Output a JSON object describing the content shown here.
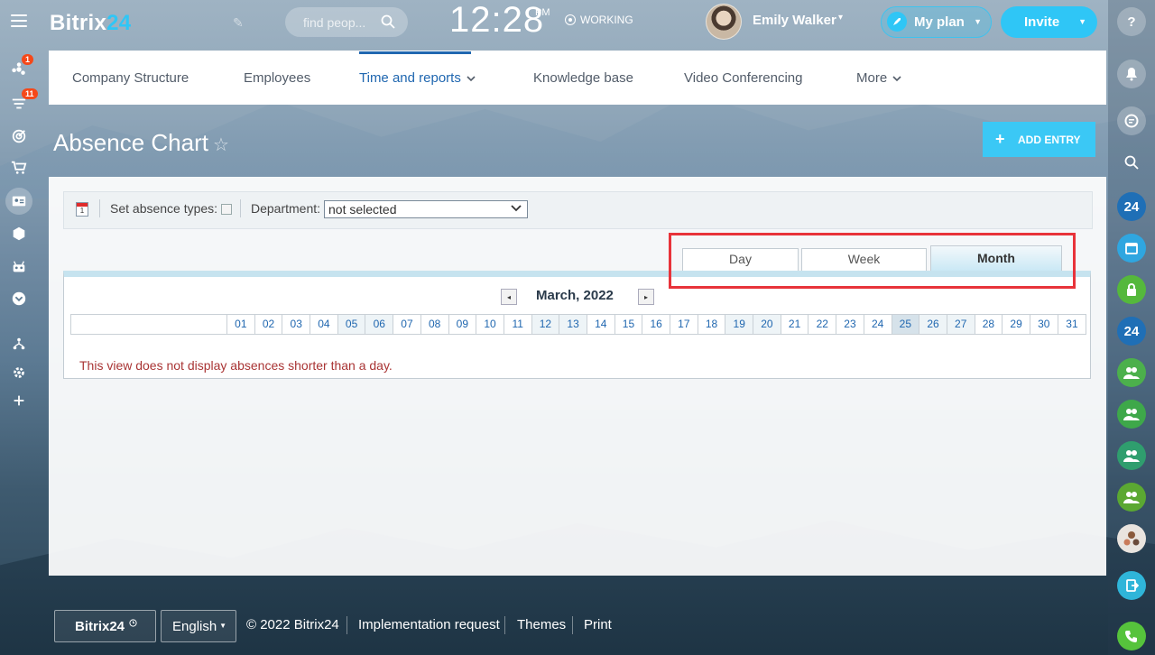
{
  "header": {
    "logo_part1": "Bitrix",
    "logo_part2": "24",
    "search_placeholder": "find peop...",
    "clock_time": "12:28",
    "clock_ampm": "PM",
    "work_status": "WORKING",
    "user_name": "Emily Walker",
    "myplan_label": "My plan",
    "invite_label": "Invite"
  },
  "left_sidebar": {
    "badges": {
      "notifications": "1",
      "feed": "11"
    }
  },
  "right_sidebar": {
    "items": [
      "help-icon",
      "bell-icon",
      "chat-icon",
      "search-icon",
      "b24-icon",
      "calendar-icon",
      "lock-icon",
      "b24-icon",
      "group-icon",
      "group-icon",
      "group-icon",
      "group-icon",
      "avatars-icon",
      "exit-icon",
      "phone-icon"
    ],
    "b24_text": "24"
  },
  "nav": {
    "items": [
      {
        "label": "Company Structure"
      },
      {
        "label": "Employees"
      },
      {
        "label": "Time and reports"
      },
      {
        "label": "Knowledge base"
      },
      {
        "label": "Video Conferencing"
      },
      {
        "label": "More"
      }
    ],
    "active": "Time and reports"
  },
  "page": {
    "title": "Absence Chart",
    "add_entry_label": "ADD ENTRY"
  },
  "toolbar": {
    "calendar_day": "1",
    "absence_types_label": "Set absence types:",
    "department_label": "Department:",
    "department_value": "not selected"
  },
  "view_tabs": [
    {
      "label": "Day"
    },
    {
      "label": "Week"
    },
    {
      "label": "Month"
    }
  ],
  "chart": {
    "month_label": "March, 2022",
    "days": [
      "01",
      "02",
      "03",
      "04",
      "05",
      "06",
      "07",
      "08",
      "09",
      "10",
      "11",
      "12",
      "13",
      "14",
      "15",
      "16",
      "17",
      "18",
      "19",
      "20",
      "21",
      "22",
      "23",
      "24",
      "25",
      "26",
      "27",
      "28",
      "29",
      "30",
      "31"
    ],
    "weekend_days": [
      "05",
      "06",
      "12",
      "13",
      "19",
      "20",
      "26",
      "27"
    ],
    "today": "25",
    "notice": "This view does not display absences shorter than a day."
  },
  "footer": {
    "logo_label": "Bitrix24",
    "language": "English",
    "copyright": "© 2022 Bitrix24",
    "links": [
      "Implementation request",
      "Themes",
      "Print"
    ]
  },
  "colors": {
    "accent": "#2fc6f6",
    "nav_active": "#2067b0",
    "highlight_box": "#e8333a",
    "notice_text": "#a93434"
  }
}
